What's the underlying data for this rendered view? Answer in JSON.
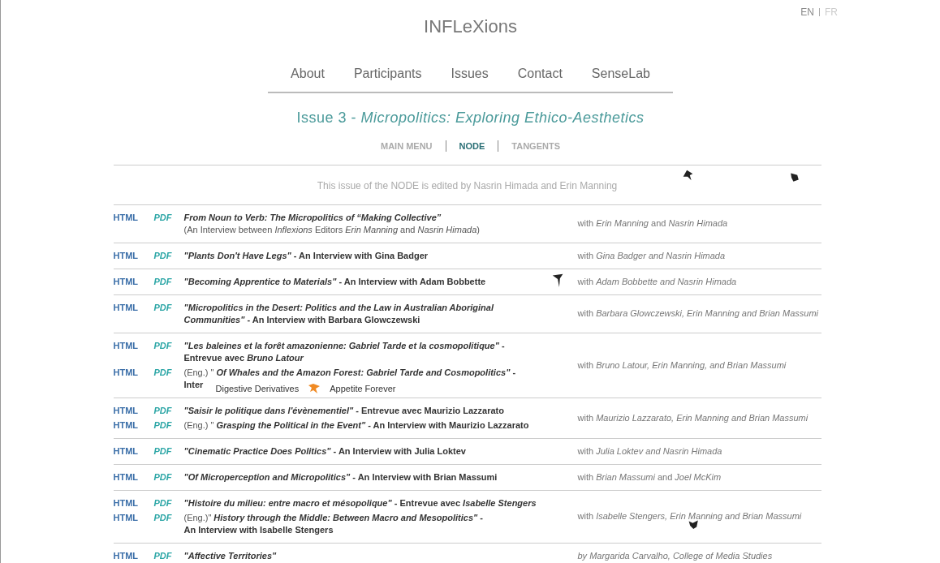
{
  "site_title": "INFLeXions",
  "languages": [
    {
      "label": "EN",
      "selected": true
    },
    {
      "label": "FR",
      "selected": false
    }
  ],
  "nav": [
    "About",
    "Participants",
    "Issues",
    "Contact",
    "SenseLab"
  ],
  "issue_title": {
    "number": "Issue 3 - ",
    "subtitle": "Micropolitics: Exploring Ethico-Aesthetics"
  },
  "sub_nav": [
    {
      "label": "MAIN MENU",
      "selected": false
    },
    {
      "label": "NODE",
      "selected": true
    },
    {
      "label": "TANGENTS",
      "selected": false
    }
  ],
  "editors_note": "This issue of the NODE is edited by Nasrin Himada and Erin Manning",
  "rows": [
    {
      "entries": [
        {
          "html": "HTML",
          "pdf": "PDF",
          "lines": [
            {
              "kind": "title",
              "text": "*From Noun to Verb: The Micropolitics of “Making Collective”*"
            },
            {
              "kind": "note",
              "text": "(An Interview between *Inflexions* Editors *Erin Manning* and *Nasrin Himada*)"
            }
          ]
        }
      ],
      "credit": "with *Erin Manning* and *Nasrin Himada*"
    },
    {
      "entries": [
        {
          "html": "HTML",
          "pdf": "PDF",
          "lines": [
            {
              "kind": "title",
              "text": "*\"Plants Don't Have Legs\"* - An Interview with Gina Badger"
            }
          ]
        }
      ],
      "credit": "with  *Gina Badger and Nasrin Himada*"
    },
    {
      "entries": [
        {
          "html": "HTML",
          "pdf": "PDF",
          "lines": [
            {
              "kind": "title",
              "text": "*\"Becoming Apprentice to Materials\"* - An Interview with Adam Bobbette"
            }
          ]
        }
      ],
      "credit": "with *Adam Bobbette and Nasrin Himada*"
    },
    {
      "entries": [
        {
          "html": "HTML",
          "pdf": "PDF",
          "lines": [
            {
              "kind": "title",
              "text": "*\"Micropolitics in the Desert: Politics and  the Law in Australian Aboriginal*"
            },
            {
              "kind": "title",
              "text": "*Communities\"* - An Interview with Barbara Glowczewski"
            }
          ]
        }
      ],
      "credit": "with *Barbara Glowczewski, Erin Manning and Brian Massumi*"
    },
    {
      "entries": [
        {
          "html": "HTML",
          "pdf": "PDF",
          "lines": [
            {
              "kind": "title",
              "text": "*\"Les baleines et la forêt amazonienne: Gabriel Tarde et la cosmopolitique\"* -"
            },
            {
              "kind": "title",
              "text": "Entrevue avec *Bruno Latour*"
            }
          ]
        },
        {
          "html": "HTML",
          "pdf": "PDF",
          "prefix": "(Eng.) \"",
          "lines": [
            {
              "kind": "title",
              "text": "*Of Whales and the Amazon Forest: Gabriel Tarde and Cosmopolitics\"* -"
            },
            {
              "kind": "title",
              "text": "Inter"
            }
          ]
        }
      ],
      "credit": "with *Bruno Latour, Erin Manning, and Brian Massumi*",
      "overlay": [
        "Digestive Derivatives",
        "Appetite Forever"
      ]
    },
    {
      "entries": [
        {
          "html": "HTML",
          "pdf": "PDF",
          "lines": [
            {
              "kind": "title",
              "text": "*\"Saisir le politique dans l'évènementiel\"* - Entrevue avec Maurizio Lazzarato"
            }
          ]
        },
        {
          "html": "HTML",
          "pdf": "PDF",
          "prefix": "(Eng.) \"",
          "lines": [
            {
              "kind": "title",
              "text": "*Grasping the Political in the Event\"* - An Interview with Maurizio Lazzarato"
            }
          ]
        }
      ],
      "credit": "with *Maurizio Lazzarato, Erin Manning and  Brian Massumi*"
    },
    {
      "entries": [
        {
          "html": "HTML",
          "pdf": "PDF",
          "lines": [
            {
              "kind": "title",
              "text": "*\"Cinematic Practice Does Politics\"* - An Interview with Julia Loktev"
            }
          ]
        }
      ],
      "credit": "with  *Julia Loktev and Nasrin Himada*"
    },
    {
      "entries": [
        {
          "html": "HTML",
          "pdf": "PDF",
          "lines": [
            {
              "kind": "title",
              "text": "*\"Of Microperception and Micropolitics\"* - An Interview with Brian Massumi"
            }
          ]
        }
      ],
      "credit": "with *Brian Massumi* and *Joel McKim*"
    },
    {
      "entries": [
        {
          "html": "HTML",
          "pdf": "PDF",
          "lines": [
            {
              "kind": "title",
              "text": "*\"Histoire du milieu: entre macro et mésopolique\"* - Entrevue avec *Isabelle Stengers*"
            }
          ]
        },
        {
          "html": "HTML",
          "pdf": "PDF",
          "prefix": "(Eng.)\"",
          "lines": [
            {
              "kind": "title",
              "text": "*History through the Middle: Between Macro and Mesopolitics\"* -"
            },
            {
              "kind": "title",
              "text": "An Interview with Isabelle Stengers"
            }
          ]
        }
      ],
      "credit": "with  *Isabelle Stengers, Erin Manning and Brian Massumi*"
    },
    {
      "entries": [
        {
          "html": "HTML",
          "pdf": "PDF",
          "lines": [
            {
              "kind": "title",
              "text": "*\"Affective Territories\"*"
            }
          ]
        }
      ],
      "credit": "*by Margarida Carvalho, College of Media Studies*"
    }
  ]
}
